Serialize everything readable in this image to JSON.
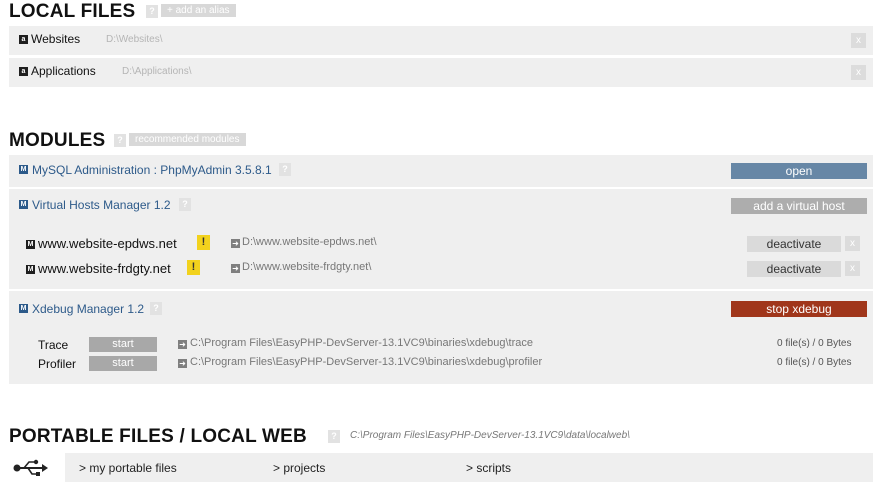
{
  "local_files": {
    "title": "LOCAL FILES",
    "help": "?",
    "add_alias": "+ add an alias",
    "items": [
      {
        "label": "Websites",
        "path": "D:\\Websites\\",
        "remove": "x"
      },
      {
        "label": "Applications",
        "path": "D:\\Applications\\",
        "remove": "x"
      }
    ]
  },
  "modules": {
    "title": "MODULES",
    "help": "?",
    "recommended": "recommended modules",
    "mysql": {
      "label": "MySQL Administration : PhpMyAdmin 3.5.8.1",
      "help": "?",
      "button": "open"
    },
    "vhosts": {
      "label": "Virtual Hosts Manager 1.2",
      "help": "?",
      "button": "add a virtual host",
      "hosts": [
        {
          "name": "www.website-epdws.net",
          "warn": "!",
          "path": "D:\\www.website-epdws.net\\",
          "button": "deactivate",
          "remove": "x"
        },
        {
          "name": "www.website-frdgty.net",
          "warn": "!",
          "path": "D:\\www.website-frdgty.net\\",
          "button": "deactivate",
          "remove": "x"
        }
      ]
    },
    "xdebug": {
      "label": "Xdebug Manager 1.2",
      "help": "?",
      "button": "stop xdebug",
      "rows": [
        {
          "label": "Trace",
          "button": "start",
          "path": "C:\\Program Files\\EasyPHP-DevServer-13.1VC9\\binaries\\xdebug\\trace",
          "size": "0 file(s) / 0 Bytes"
        },
        {
          "label": "Profiler",
          "button": "start",
          "path": "C:\\Program Files\\EasyPHP-DevServer-13.1VC9\\binaries\\xdebug\\profiler",
          "size": "0 file(s) / 0 Bytes"
        }
      ]
    }
  },
  "portable": {
    "title": "PORTABLE FILES / LOCAL WEB",
    "help": "?",
    "path": "C:\\Program Files\\EasyPHP-DevServer-13.1VC9\\data\\localweb\\",
    "links": [
      "> my portable files",
      "> projects",
      "> scripts"
    ]
  },
  "icons": {
    "folder": "square-icon",
    "usb": "usb-icon",
    "arrow": "arrow-right-box-icon"
  }
}
